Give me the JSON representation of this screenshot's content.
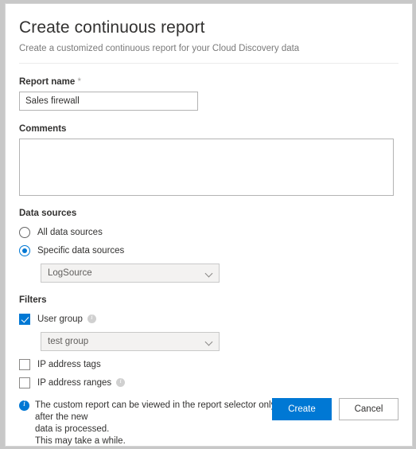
{
  "header": {
    "title": "Create continuous report",
    "subtitle": "Create a customized continuous report for your Cloud Discovery data"
  },
  "report_name": {
    "label": "Report name",
    "required_marker": "*",
    "value": "Sales firewall",
    "placeholder": ""
  },
  "comments": {
    "label": "Comments",
    "value": "",
    "placeholder": ""
  },
  "data_sources": {
    "label": "Data sources",
    "options": [
      {
        "label": "All data sources",
        "selected": false
      },
      {
        "label": "Specific data sources",
        "selected": true
      }
    ],
    "select": {
      "value": "LogSource",
      "chevron_icon": "chevron-down-icon"
    }
  },
  "filters": {
    "label": "Filters",
    "items": [
      {
        "label": "User group",
        "checked": true,
        "info_icon": "info-icon"
      },
      {
        "label": "IP address tags",
        "checked": false,
        "info_icon": ""
      },
      {
        "label": "IP address ranges",
        "checked": false,
        "info_icon": "info-icon"
      }
    ],
    "user_group_select": {
      "value": "test group",
      "chevron_icon": "chevron-down-icon"
    }
  },
  "footer": {
    "info_icon": "info-icon",
    "note_line1": "The custom report can be viewed in the report selector only after the new",
    "note_line2": "data is processed.",
    "note_line3": "This may take a while.",
    "create_label": "Create",
    "cancel_label": "Cancel"
  },
  "colors": {
    "accent": "#0078d4",
    "text": "#323130",
    "muted": "#7a7a7a",
    "border": "#b3b3b3",
    "field_bg": "#f3f2f1"
  }
}
